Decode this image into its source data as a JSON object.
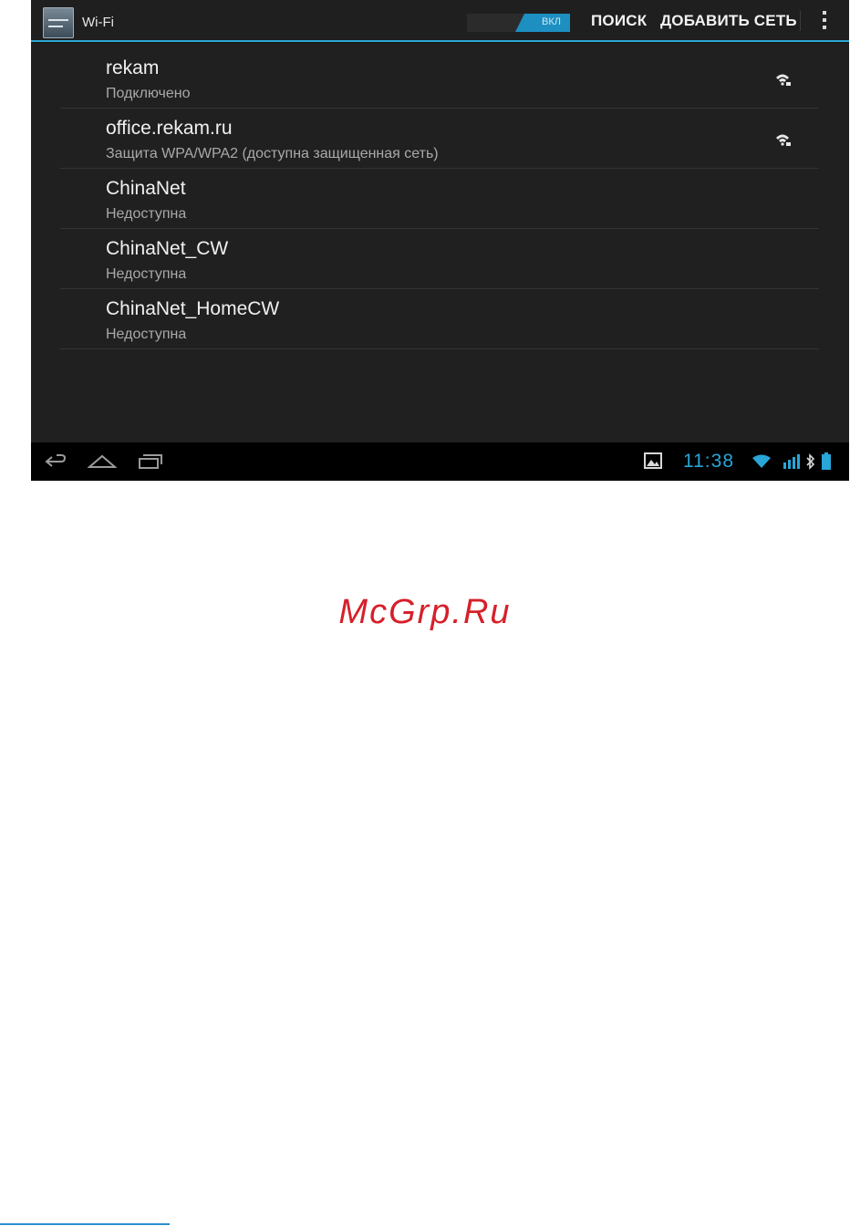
{
  "action_bar": {
    "title": "Wi-Fi",
    "toggle_label": "ВКЛ",
    "search_label": "ПОИСК",
    "add_network_label": "ДОБАВИТЬ СЕТЬ",
    "menu_icon": "overflow-menu-icon",
    "app_icon": "wifi-settings-icon"
  },
  "networks": [
    {
      "name": "rekam",
      "status": "Подключено",
      "signal_icon": "wifi-signal-lock-icon"
    },
    {
      "name": "office.rekam.ru",
      "status": "Защита WPA/WPA2 (доступна защищенная сеть)",
      "signal_icon": "wifi-signal-lock-icon"
    },
    {
      "name": "ChinaNet",
      "status": "Недоступна"
    },
    {
      "name": "ChinaNet_CW",
      "status": "Недоступна"
    },
    {
      "name": "ChinaNet_HomeCW",
      "status": "Недоступна"
    }
  ],
  "status_bar": {
    "time": "11:38",
    "icons": [
      "back-icon",
      "home-icon",
      "recent-apps-icon",
      "gallery-notification-icon",
      "wifi-icon",
      "cell-signal-icon",
      "bluetooth-icon",
      "battery-icon"
    ]
  },
  "watermark": "McGrp.Ru",
  "colors": {
    "accent": "#2aa7d6",
    "background": "#202020",
    "watermark": "#d6202a"
  }
}
